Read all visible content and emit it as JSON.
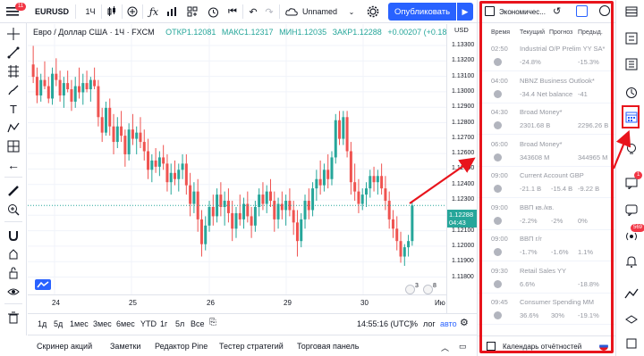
{
  "toolbar": {
    "notif_count": "11",
    "symbol": "EURUSD",
    "interval": "1Ч",
    "layout_name": "Unnamed",
    "publish": "Опубликовать"
  },
  "chart": {
    "title_name": "Евро / Доллар США · 1Ч · FXCM",
    "open": "ОТКР1.12081",
    "high": "МАКС1.12317",
    "low": "МИН1.12035",
    "close": "ЗАКР1.12288",
    "change": "+0.00207 (+0.18%)",
    "currency": "USD",
    "last_price": "1.12288",
    "countdown": "04:43",
    "price_ticks": [
      "1.13300",
      "1.13200",
      "1.13100",
      "1.13000",
      "1.12900",
      "1.12800",
      "1.12700",
      "1.12600",
      "1.12500",
      "1.12400",
      "1.12300",
      "1.12200",
      "1.12100",
      "1.12000",
      "1.11900",
      "1.11800"
    ],
    "time_ticks": [
      "24",
      "25",
      "26",
      "29",
      "30"
    ],
    "time_tick_partial": "Ию",
    "event_counts": [
      "3",
      "8"
    ]
  },
  "chart_data": {
    "type": "candlestick",
    "symbol": "EURUSD",
    "ylim": [
      1.1175,
      1.1338
    ],
    "candles": [
      [
        1.132,
        1.1332,
        1.1308,
        1.1312
      ],
      [
        1.1312,
        1.1318,
        1.1295,
        1.13
      ],
      [
        1.13,
        1.1314,
        1.1296,
        1.131
      ],
      [
        1.131,
        1.1322,
        1.1304,
        1.1306
      ],
      [
        1.1306,
        1.1312,
        1.1295,
        1.1298
      ],
      [
        1.1298,
        1.1318,
        1.1294,
        1.1314
      ],
      [
        1.1314,
        1.1324,
        1.1306,
        1.131
      ],
      [
        1.131,
        1.1316,
        1.1296,
        1.13
      ],
      [
        1.13,
        1.1312,
        1.1292,
        1.1308
      ],
      [
        1.1308,
        1.1316,
        1.1302,
        1.1304
      ],
      [
        1.1304,
        1.131,
        1.129,
        1.1296
      ],
      [
        1.1296,
        1.1312,
        1.1292,
        1.1306
      ],
      [
        1.1306,
        1.1318,
        1.1298,
        1.1302
      ],
      [
        1.1302,
        1.1314,
        1.1294,
        1.1308
      ],
      [
        1.1308,
        1.1316,
        1.1302,
        1.1304
      ],
      [
        1.1304,
        1.1312,
        1.1296,
        1.131
      ],
      [
        1.131,
        1.1318,
        1.1304,
        1.1306
      ],
      [
        1.1306,
        1.131,
        1.128,
        1.1286
      ],
      [
        1.1286,
        1.1292,
        1.127,
        1.1276
      ],
      [
        1.1276,
        1.1296,
        1.1274,
        1.1292
      ],
      [
        1.1292,
        1.1298,
        1.1274,
        1.128
      ],
      [
        1.128,
        1.1288,
        1.1262,
        1.127
      ],
      [
        1.127,
        1.1286,
        1.1266,
        1.128
      ],
      [
        1.128,
        1.129,
        1.127,
        1.1274
      ],
      [
        1.1274,
        1.1278,
        1.1254,
        1.1262
      ],
      [
        1.1262,
        1.1282,
        1.1258,
        1.1278
      ],
      [
        1.1278,
        1.1288,
        1.1268,
        1.1272
      ],
      [
        1.1272,
        1.128,
        1.1262,
        1.1276
      ],
      [
        1.1276,
        1.1286,
        1.1266,
        1.127
      ],
      [
        1.127,
        1.1278,
        1.1258,
        1.1264
      ],
      [
        1.1264,
        1.1272,
        1.1246,
        1.1252
      ],
      [
        1.1252,
        1.1262,
        1.1244,
        1.1258
      ],
      [
        1.1258,
        1.1266,
        1.125,
        1.1254
      ],
      [
        1.1254,
        1.1264,
        1.1248,
        1.126
      ],
      [
        1.126,
        1.1268,
        1.1252,
        1.1256
      ],
      [
        1.1256,
        1.1262,
        1.1238,
        1.1244
      ],
      [
        1.1244,
        1.1256,
        1.1236,
        1.125
      ],
      [
        1.125,
        1.1258,
        1.1242,
        1.1246
      ],
      [
        1.1246,
        1.1256,
        1.1238,
        1.1252
      ],
      [
        1.1252,
        1.1262,
        1.1246,
        1.1256
      ],
      [
        1.1256,
        1.1262,
        1.1236,
        1.1242
      ],
      [
        1.1242,
        1.125,
        1.1222,
        1.123
      ],
      [
        1.123,
        1.1244,
        1.1224,
        1.1238
      ],
      [
        1.1238,
        1.1246,
        1.1212,
        1.122
      ],
      [
        1.122,
        1.1226,
        1.1196,
        1.1204
      ],
      [
        1.1204,
        1.1222,
        1.12,
        1.1216
      ],
      [
        1.1216,
        1.1232,
        1.1212,
        1.1228
      ],
      [
        1.1228,
        1.1236,
        1.1216,
        1.1222
      ],
      [
        1.1222,
        1.124,
        1.1218,
        1.1236
      ],
      [
        1.1236,
        1.1244,
        1.1222,
        1.1228
      ],
      [
        1.1228,
        1.1238,
        1.1216,
        1.1232
      ],
      [
        1.1232,
        1.124,
        1.1218,
        1.1224
      ],
      [
        1.1224,
        1.1232,
        1.1206,
        1.1214
      ],
      [
        1.1214,
        1.1228,
        1.1208,
        1.1224
      ],
      [
        1.1224,
        1.1236,
        1.1216,
        1.122
      ],
      [
        1.122,
        1.1234,
        1.1214,
        1.123
      ],
      [
        1.123,
        1.1238,
        1.1218,
        1.1222
      ],
      [
        1.1222,
        1.1228,
        1.1208,
        1.1216
      ],
      [
        1.1216,
        1.1232,
        1.1212,
        1.1228
      ],
      [
        1.1228,
        1.124,
        1.1222,
        1.1236
      ],
      [
        1.1236,
        1.1244,
        1.1226,
        1.123
      ],
      [
        1.123,
        1.1242,
        1.1224,
        1.1238
      ],
      [
        1.1238,
        1.1246,
        1.1228,
        1.1232
      ],
      [
        1.1232,
        1.1238,
        1.1212,
        1.122
      ],
      [
        1.122,
        1.1234,
        1.1214,
        1.123
      ],
      [
        1.123,
        1.1238,
        1.122,
        1.1226
      ],
      [
        1.1226,
        1.1236,
        1.1216,
        1.1232
      ],
      [
        1.1232,
        1.124,
        1.1222,
        1.1226
      ],
      [
        1.1226,
        1.1232,
        1.121,
        1.1218
      ],
      [
        1.1218,
        1.1226,
        1.1196,
        1.1206
      ],
      [
        1.1206,
        1.1224,
        1.1202,
        1.122
      ],
      [
        1.122,
        1.1236,
        1.1214,
        1.1232
      ],
      [
        1.1232,
        1.124,
        1.122,
        1.1226
      ],
      [
        1.1226,
        1.1244,
        1.1222,
        1.124
      ],
      [
        1.124,
        1.1252,
        1.1232,
        1.1246
      ],
      [
        1.1246,
        1.1258,
        1.1236,
        1.1242
      ],
      [
        1.1242,
        1.1256,
        1.1238,
        1.1252
      ],
      [
        1.1252,
        1.1262,
        1.124,
        1.1246
      ],
      [
        1.1246,
        1.1264,
        1.1242,
        1.126
      ],
      [
        1.126,
        1.1288,
        1.1256,
        1.1284
      ],
      [
        1.1284,
        1.129,
        1.1268,
        1.1272
      ],
      [
        1.1272,
        1.129,
        1.1268,
        1.1286
      ],
      [
        1.1286,
        1.129,
        1.126,
        1.1264
      ],
      [
        1.1264,
        1.127,
        1.1236,
        1.1244
      ],
      [
        1.1244,
        1.1256,
        1.1232,
        1.1238
      ],
      [
        1.1238,
        1.1246,
        1.1224,
        1.123
      ],
      [
        1.123,
        1.124,
        1.1226,
        1.1236
      ],
      [
        1.1236,
        1.1244,
        1.1228,
        1.124
      ],
      [
        1.124,
        1.1252,
        1.1234,
        1.1248
      ],
      [
        1.1248,
        1.1254,
        1.1238,
        1.1244
      ],
      [
        1.1244,
        1.1252,
        1.1236,
        1.1248
      ],
      [
        1.1248,
        1.1256,
        1.1236,
        1.124
      ],
      [
        1.124,
        1.1248,
        1.1226,
        1.1232
      ],
      [
        1.1232,
        1.1238,
        1.1214,
        1.122
      ],
      [
        1.122,
        1.1226,
        1.1208,
        1.1214
      ],
      [
        1.1214,
        1.1222,
        1.12,
        1.1206
      ],
      [
        1.1206,
        1.1212,
        1.1192,
        1.1196
      ],
      [
        1.1196,
        1.1204,
        1.119,
        1.1202
      ],
      [
        1.1202,
        1.121,
        1.1196,
        1.1206
      ],
      [
        1.1206,
        1.1232,
        1.1203,
        1.1229
      ]
    ]
  },
  "timeframes": [
    "1д",
    "5д",
    "1мес",
    "3мес",
    "6мес",
    "YTD",
    "1г",
    "5л",
    "Все"
  ],
  "clock": "14:55:16 (UTC)",
  "axis_opts": [
    "%",
    "лог",
    "авто"
  ],
  "panels": [
    "Скринер акций",
    "Заметки",
    "Редактор Pine",
    "Тестер стратегий",
    "Торговая панель"
  ],
  "calendar": {
    "tab_label": "Экономичес...",
    "col_time": "Время",
    "col_actual": "Текущий",
    "col_forecast": "Прогноз",
    "col_prev": "Предыд.",
    "events": [
      {
        "time": "02:50",
        "name": "Industrial O/P Prelim YY SA*",
        "actual": "-24.8%",
        "forecast": "",
        "prev": "-15.3%"
      },
      {
        "time": "04:00",
        "name": "NBNZ Business Outlook*",
        "actual": "-34.4 Net balance",
        "forecast": "",
        "prev": "-41"
      },
      {
        "time": "04:30",
        "name": "Broad Money*",
        "actual": "2301.68 B",
        "forecast": "",
        "prev": "2296.26 B"
      },
      {
        "time": "06:00",
        "name": "Broad Money*",
        "actual": "343608 M",
        "forecast": "",
        "prev": "344965 M"
      },
      {
        "time": "09:00",
        "name": "Current Account GBP",
        "actual": "-21.1 B",
        "forecast": "-15.4 B",
        "prev": "-9.22 B"
      },
      {
        "time": "09:00",
        "name": "ВВП кв./кв.",
        "actual": "-2.2%",
        "forecast": "-2%",
        "prev": "0%"
      },
      {
        "time": "09:00",
        "name": "ВВП г/г",
        "actual": "-1.7%",
        "forecast": "-1.6%",
        "prev": "1.1%"
      },
      {
        "time": "09:30",
        "name": "Retail Sales YY",
        "actual": "6.6%",
        "forecast": "",
        "prev": "-18.8%"
      },
      {
        "time": "09:45",
        "name": "Consumer Spending MM",
        "actual": "36.6%",
        "forecast": "30%",
        "prev": "-19.1%"
      }
    ],
    "footer": "Календарь отчётностей"
  },
  "sidebar_badges": {
    "ideas": "1",
    "streams": "569"
  },
  "colors": {
    "up": "#26a69a",
    "down": "#ef5350",
    "accent": "#2962ff",
    "highlight": "#e8141c"
  }
}
